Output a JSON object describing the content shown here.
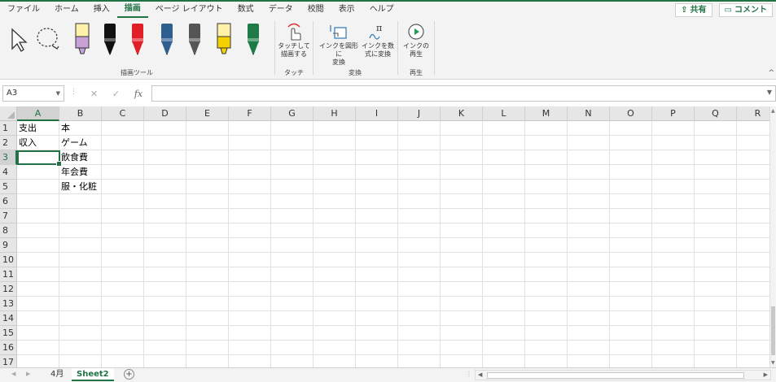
{
  "tabs": [
    {
      "label": "ファイル",
      "active": false
    },
    {
      "label": "ホーム",
      "active": false
    },
    {
      "label": "挿入",
      "active": false
    },
    {
      "label": "描画",
      "active": true
    },
    {
      "label": "ページ レイアウト",
      "active": false
    },
    {
      "label": "数式",
      "active": false
    },
    {
      "label": "データ",
      "active": false
    },
    {
      "label": "校閲",
      "active": false
    },
    {
      "label": "表示",
      "active": false
    },
    {
      "label": "ヘルプ",
      "active": false
    }
  ],
  "header": {
    "share_label": "共有",
    "comment_label": "コメント"
  },
  "ribbon": {
    "draw_tools_label": "描画ツール",
    "touch": {
      "button_line1": "タッチして",
      "button_line2": "描画する",
      "group_label": "タッチ"
    },
    "convert": {
      "shape_line1": "インクを図形に",
      "shape_line2": "変換",
      "math_line1": "インクを数",
      "math_line2": "式に変換",
      "group_label": "変換"
    },
    "replay": {
      "button_line1": "インクの",
      "button_line2": "再生",
      "group_label": "再生"
    },
    "pen_colors": [
      "#c8a2d6",
      "#111111",
      "#e01f26",
      "#2e5f8e",
      "#555555",
      "#f4d100",
      "#1e7b45"
    ]
  },
  "formula_bar": {
    "name_box": "A3",
    "fx_label": "fx",
    "value": ""
  },
  "columns": [
    "A",
    "B",
    "C",
    "D",
    "E",
    "F",
    "G",
    "H",
    "I",
    "J",
    "K",
    "L",
    "M",
    "N",
    "O",
    "P",
    "Q",
    "R"
  ],
  "rows": [
    "1",
    "2",
    "3",
    "4",
    "5",
    "6",
    "7",
    "8",
    "9",
    "10",
    "11",
    "12",
    "13",
    "14",
    "15",
    "16",
    "17"
  ],
  "selected_cell": {
    "col": "A",
    "row": "3"
  },
  "cells": {
    "A1": "支出",
    "B1": "本",
    "A2": "収入",
    "B2": "ゲーム",
    "B3": "飲食費",
    "B4": "年会費",
    "B5": "服・化粧"
  },
  "sheets": [
    {
      "label": "4月",
      "active": false
    },
    {
      "label": "Sheet2",
      "active": true
    }
  ],
  "add_sheet_label": "+"
}
